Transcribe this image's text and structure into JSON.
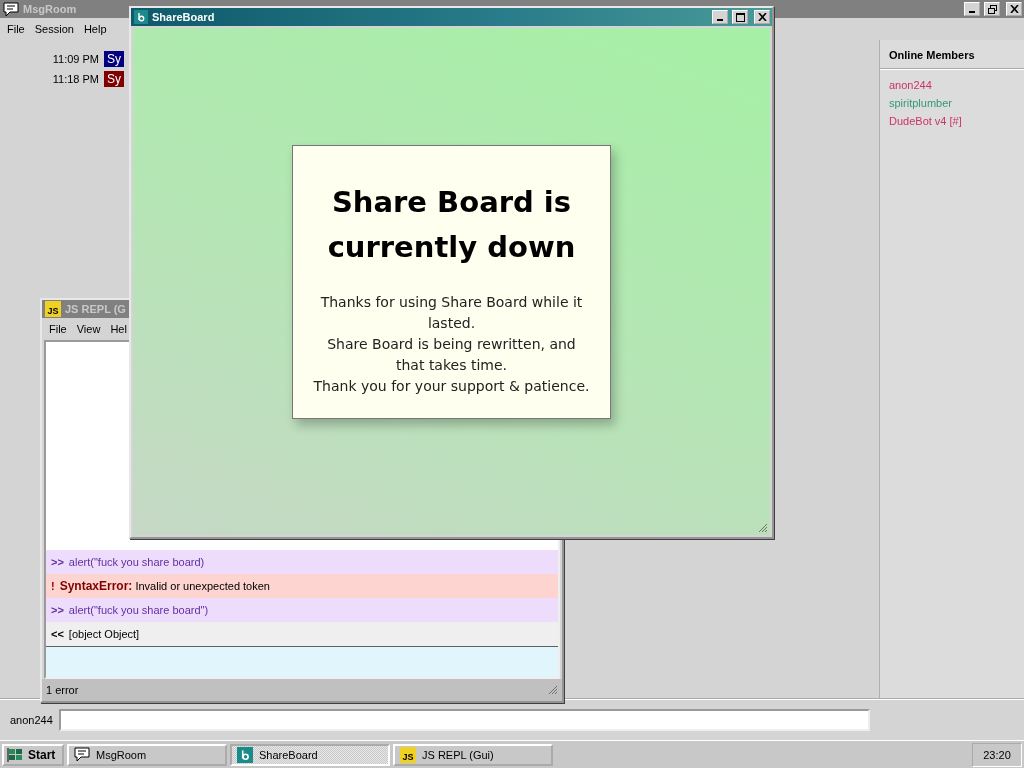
{
  "msgroom": {
    "title": "MsgRoom",
    "active": false,
    "maximized": true,
    "menu": [
      "File",
      "Session",
      "Help"
    ],
    "messages": [
      {
        "time": "11:09 PM",
        "sender": "Sy",
        "color": "#000080"
      },
      {
        "time": "11:18 PM",
        "sender": "Sy",
        "color": "#800000"
      }
    ],
    "members_title": "Online Members",
    "members": [
      {
        "name": "anon244",
        "color": "#cc3366"
      },
      {
        "name": "spiritplumber",
        "color": "#339977"
      },
      {
        "name": "DudeBot v4 [#]",
        "color": "#cc3366"
      }
    ],
    "input": {
      "label": "anon244"
    }
  },
  "repl": {
    "title": "JS REPL (G",
    "badge": "JS",
    "active": false,
    "menu": [
      "File",
      "View",
      "Hel"
    ],
    "entries": [
      {
        "kind": "input",
        "prefix": ">>",
        "text": "alert(\"fuck you share board)"
      },
      {
        "kind": "error",
        "prefix": "!",
        "text": "**SyntaxError:** Invalid or unexpected token"
      },
      {
        "kind": "input",
        "prefix": ">>",
        "text": "alert(\"fuck you share board\")"
      },
      {
        "kind": "output",
        "prefix": "<<",
        "text": "[object Object]"
      }
    ],
    "status": "1 error"
  },
  "shareboard": {
    "title": "ShareBoard",
    "active": true,
    "maximized": false,
    "heading": "Share Board is currently down",
    "body": [
      "Thanks for using Share Board while it lasted.",
      "Share Board is being rewritten, and that takes time.",
      "Thank you for your support & patience."
    ]
  },
  "taskbar": {
    "start": "Start",
    "tasks": [
      {
        "kind": "chat",
        "label": "MsgRoom",
        "selected": false
      },
      {
        "kind": "board",
        "label": "ShareBoard",
        "selected": true
      },
      {
        "kind": "js",
        "badge": "JS",
        "label": "JS REPL (Gui)",
        "selected": false
      }
    ],
    "clock": "23:20"
  }
}
